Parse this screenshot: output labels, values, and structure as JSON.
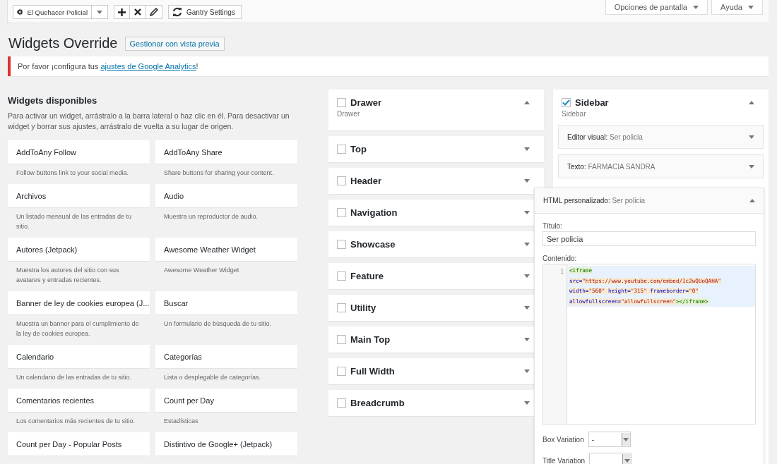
{
  "toolbar": {
    "site_selector": "El Quehacer Policial",
    "gantry_button": "Gantry Settings"
  },
  "screen_tabs": [
    {
      "label": "Opciones de pantalla"
    },
    {
      "label": "Ayuda"
    }
  ],
  "page_title": "Widgets Override",
  "title_action": "Gestionar con vista previa",
  "notice": {
    "before": "Por favor ¡configura tus ",
    "link": "ajustes de Google Analytics",
    "after": "!"
  },
  "available": {
    "heading": "Widgets disponibles",
    "description": "Para activar un widget, arrástralo a la barra lateral o haz clic en él. Para desactivar un widget y borrar sus ajustes, arrástralo de vuelta a su lugar de origen.",
    "widgets": [
      {
        "title": "AddToAny Follow",
        "description": "Follow buttons link to your social media."
      },
      {
        "title": "AddToAny Share",
        "description": "Share buttons for sharing your content."
      },
      {
        "title": "Archivos",
        "description": "Un listado mensual de las entradas de tu sitio."
      },
      {
        "title": "Audio",
        "description": "Muestra un reproductor de audio."
      },
      {
        "title": "Autores (Jetpack)",
        "description": "Muestra los autores del sitio con sus avatares y entradas recientes."
      },
      {
        "title": "Awesome Weather Widget",
        "description": "Awesome Weather Widget"
      },
      {
        "title": "Banner de ley de cookies europea (J...",
        "description": "Muestra un banner para el cumplimiento de la ley de cookies europea."
      },
      {
        "title": "Buscar",
        "description": "Un formulario de búsqueda de tu sitio."
      },
      {
        "title": "Calendario",
        "description": "Un calendario de las entradas de tu sitio."
      },
      {
        "title": "Categorías",
        "description": "Lista o desplegable de categorías."
      },
      {
        "title": "Comentarios recientes",
        "description": "Los comentarios más recientes de tu sitio."
      },
      {
        "title": "Count per Day",
        "description": "Estadísticas"
      },
      {
        "title": "Count per Day - Popular Posts"
      },
      {
        "title": "Distintivo de Google+ (Jetpack)"
      }
    ]
  },
  "sidebar_columns": [
    {
      "sidebars": [
        {
          "name": "Drawer",
          "checked": false,
          "expanded": true,
          "description": "Drawer"
        },
        {
          "name": "Top",
          "checked": false,
          "expanded": false
        },
        {
          "name": "Header",
          "checked": false,
          "expanded": false
        },
        {
          "name": "Navigation",
          "checked": false,
          "expanded": false
        },
        {
          "name": "Showcase",
          "checked": false,
          "expanded": false
        },
        {
          "name": "Feature",
          "checked": false,
          "expanded": false
        },
        {
          "name": "Utility",
          "checked": false,
          "expanded": false
        },
        {
          "name": "Main Top",
          "checked": false,
          "expanded": false
        },
        {
          "name": "Full Width",
          "checked": false,
          "expanded": false
        },
        {
          "name": "Breadcrumb",
          "checked": false,
          "expanded": false
        }
      ]
    },
    {
      "sidebars": [
        {
          "name": "Sidebar",
          "checked": true,
          "expanded": true,
          "description": "Sidebar",
          "widgets": [
            {
              "title": "Editor visual:",
              "instance": "Ser policia",
              "expanded": false
            },
            {
              "title": "Texto:",
              "instance": "FARMACIA SANDRA",
              "expanded": false
            },
            {
              "title": "HTML personalizado:",
              "instance": "Ser policia",
              "expanded": true,
              "floating": true,
              "fields": [
                {
                  "kind": "text",
                  "label": "Título:",
                  "value": "Ser policia"
                },
                {
                  "kind": "code",
                  "label": "Contenido:",
                  "line_number": "1",
                  "lines": [
                    [
                      {
                        "kind": "tag",
                        "text": "<iframe"
                      }
                    ],
                    [
                      {
                        "kind": "attr",
                        "text": "src="
                      },
                      {
                        "kind": "string",
                        "text": "\"https://www.youtube.com/embed/Ic2wQUoQAHA\""
                      }
                    ],
                    [
                      {
                        "kind": "attr",
                        "text": "width="
                      },
                      {
                        "kind": "string",
                        "text": "\"560\" "
                      },
                      {
                        "kind": "attr",
                        "text": "height="
                      },
                      {
                        "kind": "string",
                        "text": "\"315\" "
                      },
                      {
                        "kind": "attr",
                        "text": "frameborder="
                      },
                      {
                        "kind": "string",
                        "text": "\"0\""
                      }
                    ],
                    [
                      {
                        "kind": "attr",
                        "text": "allowfullscreen="
                      },
                      {
                        "kind": "string",
                        "text": "\"allowfullscreen\""
                      },
                      {
                        "kind": "tag",
                        "text": "></iframe>"
                      }
                    ]
                  ]
                },
                {
                  "kind": "select",
                  "label": "Box Variation",
                  "value": "-"
                },
                {
                  "kind": "select",
                  "label": "Title Variation"
                }
              ]
            }
          ]
        }
      ]
    }
  ]
}
